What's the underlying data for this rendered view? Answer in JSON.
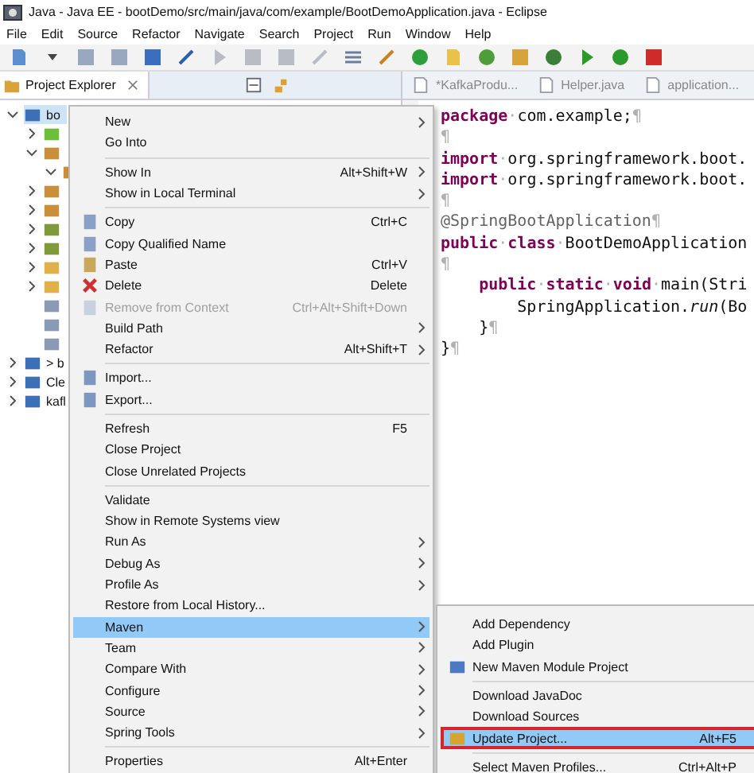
{
  "window": {
    "title": "Java - Java EE - bootDemo/src/main/java/com/example/BootDemoApplication.java - Eclipse"
  },
  "menubar": [
    "File",
    "Edit",
    "Source",
    "Refactor",
    "Navigate",
    "Search",
    "Project",
    "Run",
    "Window",
    "Help"
  ],
  "explorer": {
    "title": "Project Explorer",
    "tree": [
      {
        "label": "bo",
        "expanded": true,
        "selected": true,
        "children": [
          {
            "expanded": false,
            "selected": false
          },
          {
            "expanded": true,
            "selected": false,
            "children": [
              {
                "expanded": true,
                "selected": false
              }
            ]
          },
          {
            "expanded": false,
            "selected": false
          },
          {
            "expanded": false,
            "selected": false
          },
          {
            "expanded": false,
            "selected": false
          },
          {
            "expanded": false,
            "selected": false
          },
          {
            "expanded": false,
            "selected": false
          },
          {
            "expanded": false,
            "selected": false
          },
          {
            "selected": false
          },
          {
            "selected": false
          },
          {
            "selected": false
          }
        ]
      },
      {
        "label": "> b",
        "expanded": false,
        "selected": false
      },
      {
        "label": "Cle",
        "expanded": false,
        "selected": false
      },
      {
        "label": "kafl",
        "expanded": false,
        "selected": false
      }
    ]
  },
  "editor": {
    "tabs": [
      {
        "label": "*KafkaProdu...",
        "selected": false
      },
      {
        "label": "Helper.java",
        "selected": false
      },
      {
        "label": "application...",
        "selected": false
      }
    ],
    "lines": [
      [
        {
          "kind": "kw",
          "text": "package"
        },
        {
          "kind": "ws",
          "text": "·"
        },
        {
          "kind": "plain",
          "text": "com.example;"
        },
        {
          "kind": "ws",
          "text": "¶"
        }
      ],
      [
        {
          "kind": "ws",
          "text": "¶"
        }
      ],
      [
        {
          "kind": "kw",
          "text": "import"
        },
        {
          "kind": "ws",
          "text": "·"
        },
        {
          "kind": "plain",
          "text": "org.springframework.boot."
        }
      ],
      [
        {
          "kind": "kw",
          "text": "import"
        },
        {
          "kind": "ws",
          "text": "·"
        },
        {
          "kind": "plain",
          "text": "org.springframework.boot."
        }
      ],
      [
        {
          "kind": "ws",
          "text": "¶"
        }
      ],
      [
        {
          "kind": "annot",
          "text": "@SpringBootApplication"
        },
        {
          "kind": "ws",
          "text": "¶"
        }
      ],
      [
        {
          "kind": "kw",
          "text": "public"
        },
        {
          "kind": "ws",
          "text": "·"
        },
        {
          "kind": "kw",
          "text": "class"
        },
        {
          "kind": "ws",
          "text": "·"
        },
        {
          "kind": "plain",
          "text": "BootDemoApplication"
        }
      ],
      [
        {
          "kind": "ws",
          "text": "¶"
        }
      ],
      [
        {
          "kind": "kw",
          "text": "    public"
        },
        {
          "kind": "ws",
          "text": "·"
        },
        {
          "kind": "kw",
          "text": "static"
        },
        {
          "kind": "ws",
          "text": "·"
        },
        {
          "kind": "kw",
          "text": "void"
        },
        {
          "kind": "ws",
          "text": "·"
        },
        {
          "kind": "plain",
          "text": "main(Stri"
        }
      ],
      [
        {
          "kind": "plain",
          "text": "        SpringApplication."
        },
        {
          "kind": "italic",
          "text": "run"
        },
        {
          "kind": "plain",
          "text": "(Bo"
        }
      ],
      [
        {
          "kind": "plain",
          "text": "    }"
        },
        {
          "kind": "ws",
          "text": "¶"
        }
      ],
      [
        {
          "kind": "plain",
          "text": "}"
        },
        {
          "kind": "ws",
          "text": "¶"
        }
      ]
    ]
  },
  "context_menu": {
    "groups": [
      [
        {
          "label": "New",
          "submenu": true,
          "disabled": false,
          "selected": false
        },
        {
          "label": "Go Into",
          "submenu": false,
          "disabled": false,
          "selected": false
        }
      ],
      [
        {
          "label": "Show In",
          "shortcut": "Alt+Shift+W",
          "submenu": true,
          "disabled": false,
          "selected": false
        },
        {
          "label": "Show in Local Terminal",
          "submenu": true,
          "disabled": false,
          "selected": false
        }
      ],
      [
        {
          "label": "Copy",
          "shortcut": "Ctrl+C",
          "submenu": false,
          "disabled": false,
          "selected": false
        },
        {
          "label": "Copy Qualified Name",
          "submenu": false,
          "disabled": false,
          "selected": false
        },
        {
          "label": "Paste",
          "shortcut": "Ctrl+V",
          "submenu": false,
          "disabled": false,
          "selected": false
        },
        {
          "label": "Delete",
          "shortcut": "Delete",
          "submenu": false,
          "disabled": false,
          "selected": false
        },
        {
          "label": "Remove from Context",
          "shortcut": "Ctrl+Alt+Shift+Down",
          "submenu": false,
          "disabled": true,
          "selected": false
        },
        {
          "label": "Build Path",
          "submenu": true,
          "disabled": false,
          "selected": false
        },
        {
          "label": "Refactor",
          "shortcut": "Alt+Shift+T",
          "submenu": true,
          "disabled": false,
          "selected": false
        }
      ],
      [
        {
          "label": "Import...",
          "submenu": false,
          "disabled": false,
          "selected": false
        },
        {
          "label": "Export...",
          "submenu": false,
          "disabled": false,
          "selected": false
        }
      ],
      [
        {
          "label": "Refresh",
          "shortcut": "F5",
          "submenu": false,
          "disabled": false,
          "selected": false
        },
        {
          "label": "Close Project",
          "submenu": false,
          "disabled": false,
          "selected": false
        },
        {
          "label": "Close Unrelated Projects",
          "submenu": false,
          "disabled": false,
          "selected": false
        }
      ],
      [
        {
          "label": "Validate",
          "submenu": false,
          "disabled": false,
          "selected": false
        },
        {
          "label": "Show in Remote Systems view",
          "submenu": false,
          "disabled": false,
          "selected": false
        },
        {
          "label": "Run As",
          "submenu": true,
          "disabled": false,
          "selected": false
        },
        {
          "label": "Debug As",
          "submenu": true,
          "disabled": false,
          "selected": false
        },
        {
          "label": "Profile As",
          "submenu": true,
          "disabled": false,
          "selected": false
        },
        {
          "label": "Restore from Local History...",
          "submenu": false,
          "disabled": false,
          "selected": false
        },
        {
          "label": "Maven",
          "submenu": true,
          "disabled": false,
          "selected": true
        },
        {
          "label": "Team",
          "submenu": true,
          "disabled": false,
          "selected": false
        },
        {
          "label": "Compare With",
          "submenu": true,
          "disabled": false,
          "selected": false
        },
        {
          "label": "Configure",
          "submenu": true,
          "disabled": false,
          "selected": false
        },
        {
          "label": "Source",
          "submenu": true,
          "disabled": false,
          "selected": false
        },
        {
          "label": "Spring Tools",
          "submenu": true,
          "disabled": false,
          "selected": false
        }
      ],
      [
        {
          "label": "Properties",
          "shortcut": "Alt+Enter",
          "submenu": false,
          "disabled": false,
          "selected": false
        }
      ]
    ]
  },
  "maven_submenu": {
    "groups": [
      [
        {
          "label": "Add Dependency",
          "selected": false
        },
        {
          "label": "Add Plugin",
          "selected": false
        },
        {
          "label": "New Maven Module Project",
          "selected": false
        }
      ],
      [
        {
          "label": "Download JavaDoc",
          "selected": false
        },
        {
          "label": "Download Sources",
          "selected": false
        },
        {
          "label": "Update Project...",
          "shortcut": "Alt+F5",
          "selected": true
        }
      ],
      [
        {
          "label": "Select Maven Profiles...",
          "shortcut": "Ctrl+Alt+P",
          "selected": false
        }
      ]
    ]
  }
}
